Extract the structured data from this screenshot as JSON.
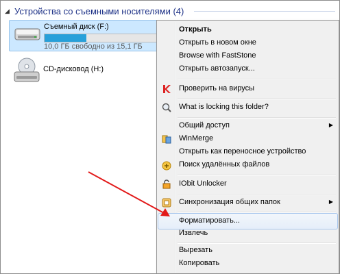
{
  "group": {
    "title": "Устройства со съемными носителями (4)"
  },
  "drives": {
    "f": {
      "label": "Съемный диск (F:)",
      "meta": "10,0 ГБ свободно из 15,1 ГБ",
      "used_fraction": 0.34
    },
    "h": {
      "label": "CD-дисковод (H:)"
    }
  },
  "menu": {
    "open": "Открыть",
    "open_new_window": "Открыть в новом окне",
    "browse_faststone": "Browse with FastStone",
    "open_autoplay": "Открыть автозапуск...",
    "scan_viruses": "Проверить на вирусы",
    "locking": "What is locking this folder?",
    "share": "Общий доступ",
    "winmerge": "WinMerge",
    "open_portable": "Открыть как переносное устройство",
    "find_deleted": "Поиск удалённых файлов",
    "iobit": "IObit Unlocker",
    "sync_shared": "Синхронизация общих папок",
    "format": "Форматировать...",
    "eject": "Извлечь",
    "cut": "Вырезать",
    "copy": "Копировать"
  },
  "colors": {
    "accent": "#26a0da",
    "annotation": "#e21a1a",
    "group_title": "#1e3287"
  }
}
